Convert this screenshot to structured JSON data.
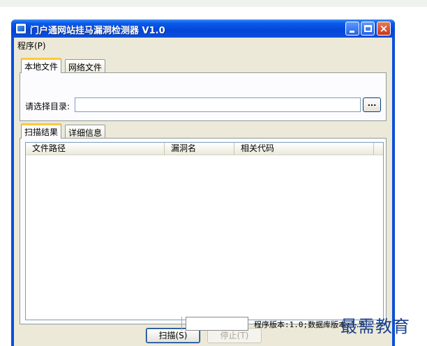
{
  "window": {
    "title": "门户通网站挂马漏洞检测器 V1.0",
    "icon": "app-icon",
    "controls": [
      "minimize-icon",
      "maximize-icon",
      "close-icon"
    ],
    "close_glyph": "×"
  },
  "menu": {
    "items": [
      {
        "label": "程序(P)"
      }
    ]
  },
  "source_tabs": [
    {
      "label": "本地文件",
      "active": true
    },
    {
      "label": "网络文件",
      "active": false
    }
  ],
  "directory": {
    "label": "请选择目录:",
    "value": "",
    "placeholder": "",
    "browse_label": "..."
  },
  "result_tabs": [
    {
      "label": "扫描结果",
      "active": true
    },
    {
      "label": "详细信息",
      "active": false
    }
  ],
  "results_table": {
    "columns": [
      "文件路径",
      "漏洞名",
      "相关代码"
    ],
    "rows": []
  },
  "buttons": {
    "scan": "扫描(S)",
    "stop": "停止(T)"
  },
  "status": {
    "version_text": "程序版本:1.0;数据库版本:1.0"
  },
  "watermark": "最需教育",
  "colors": {
    "titlebar": "#0545d8",
    "active_tab_accent": "#ffc83c",
    "face": "#ece9d8"
  }
}
